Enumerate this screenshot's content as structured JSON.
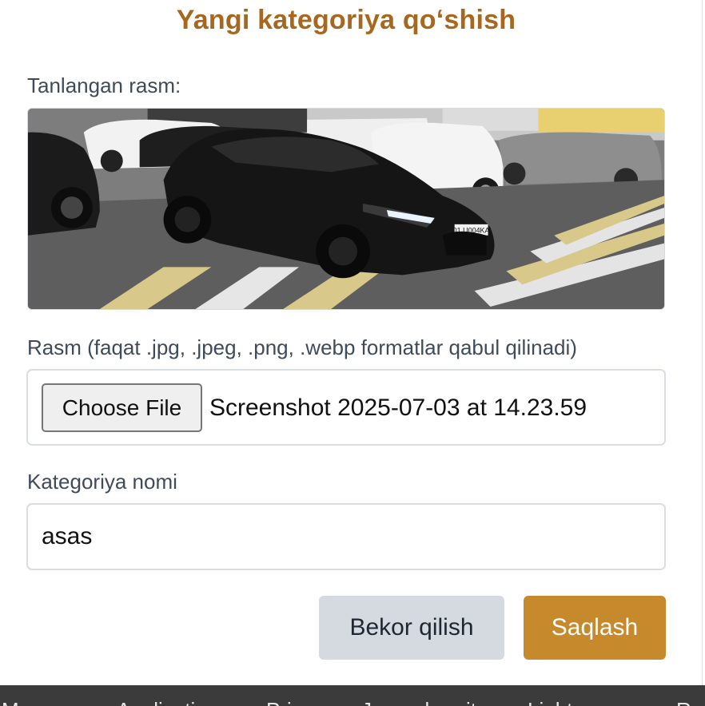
{
  "modal": {
    "title": "Yangi kategoriya qoʻshish",
    "selected_image_label": "Tanlangan rasm:",
    "file_label": "Rasm (faqat .jpg, .jpeg, .png, .webp formatlar qabul qilinadi)",
    "file_button_label": "Choose File",
    "file_name": "Screenshot 2025-07-03 at 14.23.59",
    "name_label": "Kategoriya nomi",
    "name_value": "asas",
    "cancel_label": "Bekor qilish",
    "save_label": "Saqlash",
    "preview_plate": "01 U004KA"
  },
  "footer": {
    "items": [
      "M",
      "Application",
      "Privacy",
      "Journal",
      "city",
      "Light",
      "R"
    ]
  },
  "colors": {
    "title": "#a8671f",
    "save_button": "#c68a2c",
    "cancel_button": "#d5d9e0",
    "footer": "#3b3b3b"
  }
}
